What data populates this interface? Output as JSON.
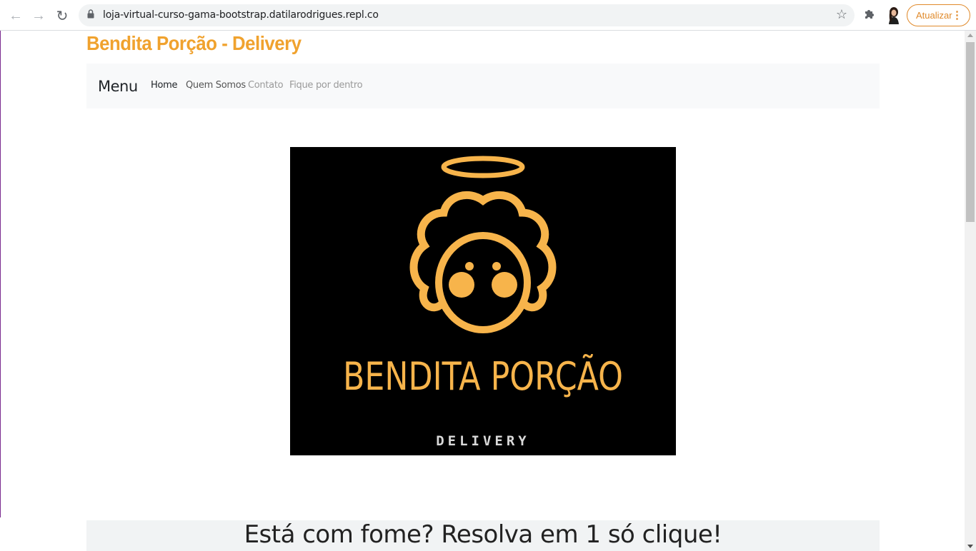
{
  "browser": {
    "url": "loja-virtual-curso-gama-bootstrap.datilarodrigues.repl.co",
    "update_label": "Atualizar",
    "icons": {
      "back": "arrow-left-icon",
      "forward": "arrow-right-icon",
      "reload": "reload-icon",
      "lock": "lock-icon",
      "bookmark": "star-icon",
      "extensions": "puzzle-icon",
      "menu": "vertical-dots-icon"
    },
    "accent_color": "#e08a2b"
  },
  "site": {
    "brand": "Bendita Porção - Delivery",
    "brand_color": "#f0a22e",
    "navbar": {
      "brand": "Menu",
      "links": [
        "Home",
        "Quem Somos",
        "Contato",
        "Fique por dentro"
      ]
    },
    "logo": {
      "title": "BENDITA PORÇÃO",
      "subtitle": "DELIVERY",
      "color": "#f7b44b"
    },
    "tagline": "Está com fome? Resolva em 1 só clique!"
  }
}
